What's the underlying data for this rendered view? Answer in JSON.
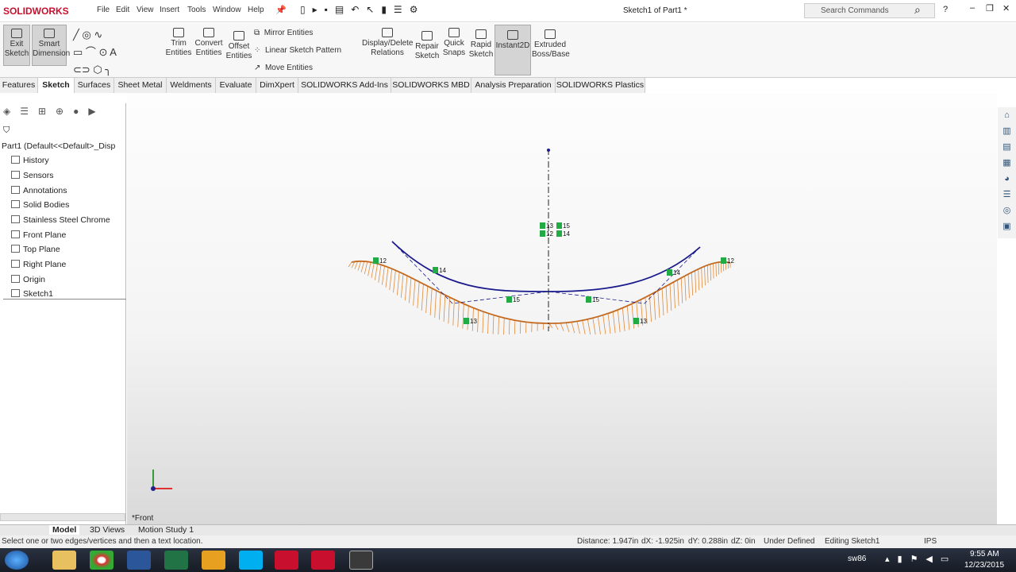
{
  "app": {
    "logo": "SOLIDWORKS",
    "title": "Sketch1 of Part1 *",
    "search_placeholder": "Search Commands"
  },
  "menu": [
    "File",
    "Edit",
    "View",
    "Insert",
    "Tools",
    "Window",
    "Help"
  ],
  "ribbon": {
    "exit_sketch": "Exit Sketch",
    "smart_dimension": "Smart Dimension",
    "trim": "Trim Entities",
    "convert": "Convert Entities",
    "offset": "Offset Entities",
    "mirror": "Mirror Entities",
    "linear_pattern": "Linear Sketch Pattern",
    "move": "Move Entities",
    "display_relations": "Display/Delete Relations",
    "repair": "Repair Sketch",
    "quick_snaps": "Quick Snaps",
    "rapid": "Rapid Sketch",
    "instant2d": "Instant2D",
    "extruded": "Extruded Boss/Base"
  },
  "tabs": [
    "Features",
    "Sketch",
    "Surfaces",
    "Sheet Metal",
    "Weldments",
    "Evaluate",
    "DimXpert",
    "SOLIDWORKS Add-Ins",
    "SOLIDWORKS MBD",
    "Analysis Preparation",
    "SOLIDWORKS Plastics"
  ],
  "active_tab": "Sketch",
  "tree": {
    "root": "Part1  (Default<<Default>_Disp",
    "items": [
      "History",
      "Sensors",
      "Annotations",
      "Solid Bodies",
      "Stainless Steel Chrome",
      "Front Plane",
      "Top Plane",
      "Right Plane",
      "Origin",
      "Sketch1"
    ]
  },
  "viewport": {
    "view_label": "*Front",
    "relation_tags": [
      "13",
      "15",
      "12",
      "14"
    ]
  },
  "bottom_tabs": [
    "Model",
    "3D Views",
    "Motion Study 1"
  ],
  "status": {
    "message": "Select one or two edges/vertices and then a text location.",
    "distance": "Distance: 1.947in",
    "dx": "dX: -1.925in",
    "dy": "dY: 0.288in",
    "dz": "dZ: 0in",
    "state": "Under Defined",
    "editing": "Editing Sketch1",
    "units": "IPS"
  },
  "taskbar": {
    "user": "sw86",
    "time": "9:55 AM",
    "date": "12/23/2015"
  },
  "colors": {
    "curve": "#1a1a8c",
    "comb": "#e08a3c",
    "relation": "#22aa44"
  }
}
